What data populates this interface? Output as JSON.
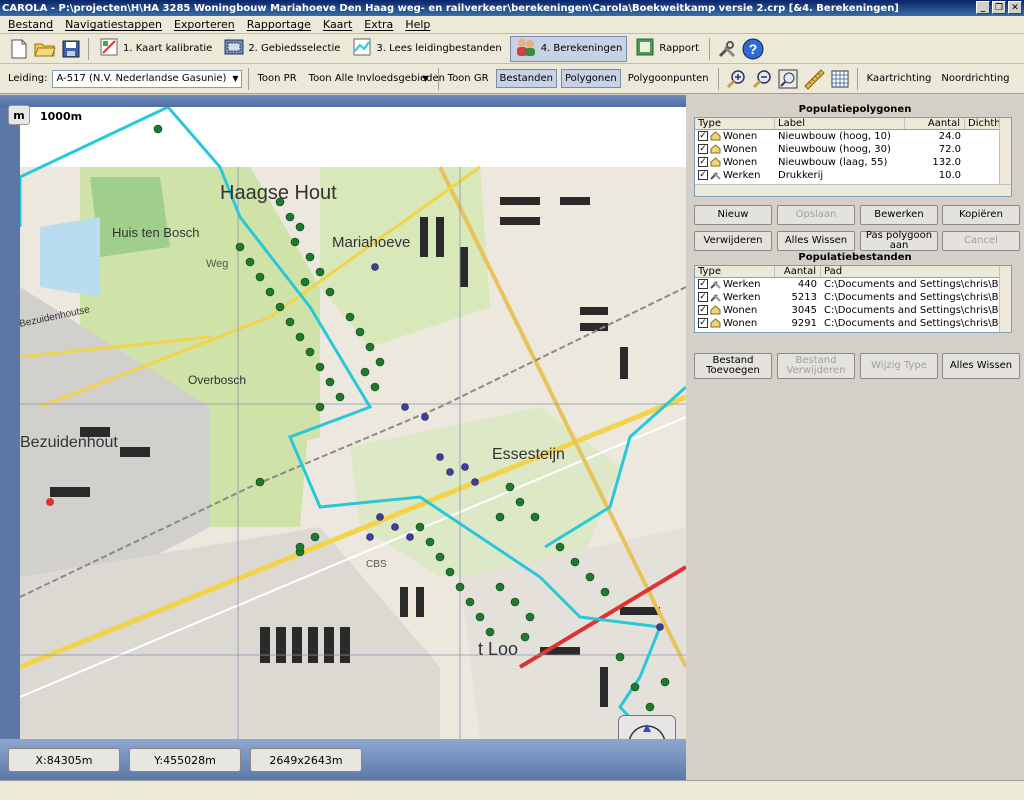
{
  "window": {
    "title": "CAROLA - P:\\projecten\\H\\HA 3285 Woningbouw Mariahoeve Den Haag  weg- en railverkeer\\berekeningen\\Carola\\Boekweitkamp versie 2.crp [&4. Berekeningen]",
    "min": "_",
    "max": "❐",
    "close": "✕"
  },
  "menu": [
    "Bestand",
    "Navigatiestappen",
    "Exporteren",
    "Rapportage",
    "Kaart",
    "Extra",
    "Help"
  ],
  "toolbar1": {
    "btn1": "1. Kaart kalibratie",
    "btn2": "2. Gebiedsselectie",
    "btn3": "3. Lees leidingbestanden",
    "btn4": "4. Berekeningen",
    "btn5": "Rapport"
  },
  "toolbar2": {
    "leiding_label": "Leiding:",
    "leiding_value": "A-517 (N.V. Nederlandse Gasunie)",
    "toon_pr": "Toon PR",
    "invloed_value": "Toon Alle Invloedsgebieden",
    "toon_gr": "Toon GR",
    "bestanden": "Bestanden",
    "polygonen": "Polygonen",
    "polygoonpunten": "Polygoonpunten",
    "kaartrichting": "Kaartrichting",
    "noordrichting": "Noordrichting"
  },
  "map": {
    "scale_button": "m",
    "scale_label": "1000m",
    "labels": {
      "l1": "Haagse Hout",
      "l2": "Mariahoeve",
      "l3": "Huis ten Bosch",
      "l4": "Bezuidenhout",
      "l5": "Overbosch",
      "l6": "Essesteijn",
      "l7": "t Loo",
      "l8": "Weg",
      "l9": "Bezuidenhoutse",
      "l10": "CBS"
    },
    "x": "X:84305m",
    "y": "Y:455028m",
    "size": "2649x2643m",
    "compass": "0"
  },
  "populatiepolygonen": {
    "title": "Populatiepolygonen",
    "columns": [
      "Type",
      "Label",
      "Aantal",
      "Dichth"
    ],
    "rows": [
      {
        "type": "Wonen",
        "label": "Nieuwbouw (hoog, 10)",
        "aantal": "24.0"
      },
      {
        "type": "Wonen",
        "label": "Nieuwbouw (hoog, 30)",
        "aantal": "72.0"
      },
      {
        "type": "Wonen",
        "label": "Nieuwbouw (laag, 55)",
        "aantal": "132.0"
      },
      {
        "type": "Werken",
        "label": "Drukkerij",
        "aantal": "10.0"
      }
    ],
    "buttons": {
      "nieuw": "Nieuw",
      "opslaan": "Opslaan",
      "bewerken": "Bewerken",
      "kopieren": "Kopiëren",
      "verwijderen": "Verwijderen",
      "alles_wissen": "Alles Wissen",
      "pas_polygoon": "Pas polygoon aan",
      "cancel": "Cancel"
    }
  },
  "populatiebestanden": {
    "title": "Populatiebestanden",
    "columns": [
      "Type",
      "Aantal",
      "Pad"
    ],
    "rows": [
      {
        "type": "Werken",
        "aantal": "440",
        "pad": "C:\\Documents and Settings\\chris\\Bureaublad"
      },
      {
        "type": "Werken",
        "aantal": "5213",
        "pad": "C:\\Documents and Settings\\chris\\Bureaublad"
      },
      {
        "type": "Wonen",
        "aantal": "3045",
        "pad": "C:\\Documents and Settings\\chris\\Bureaublad"
      },
      {
        "type": "Wonen",
        "aantal": "9291",
        "pad": "C:\\Documents and Settings\\chris\\Bureaublad"
      }
    ],
    "buttons": {
      "toevoegen_1": "Bestand",
      "toevoegen_2": "Toevoegen",
      "verwijderen_1": "Bestand",
      "verwijderen_2": "Verwijderen",
      "wijzig_type": "Wijzig Type",
      "alles_wissen": "Alles Wissen"
    }
  },
  "colors": {
    "title_start": "#0a246a",
    "title_end": "#3a6ea5",
    "pipeline": "#29c8d8",
    "greenery": "#cfe3a8",
    "road_yellow": "#f2d34a",
    "dot_green": "#1f7a2e",
    "dot_blue": "#3f3ea0"
  }
}
